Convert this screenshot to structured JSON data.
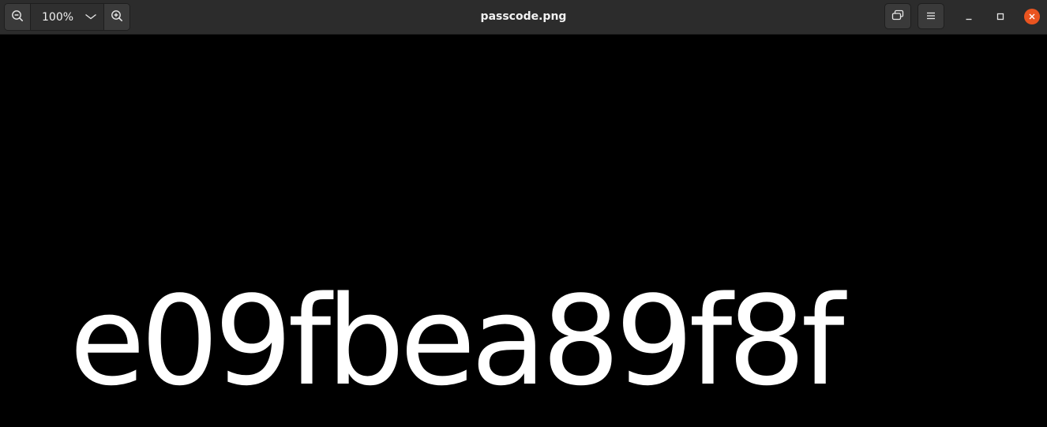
{
  "app": {
    "title": "passcode.png"
  },
  "toolbar": {
    "zoom_out_icon": "zoom-out-icon",
    "zoom_level": "100%",
    "zoom_dropdown_icon": "chevron-down-icon",
    "zoom_in_icon": "zoom-in-icon",
    "fit_window_icon": "restore-icon",
    "menu_icon": "hamburger-menu-icon"
  },
  "window_controls": {
    "minimize_icon": "minimize-icon",
    "maximize_icon": "maximize-icon",
    "close_icon": "close-icon",
    "close_color": "#e95420"
  },
  "image": {
    "text": "e09fbea89f8f",
    "background": "#000000",
    "foreground": "#ffffff"
  }
}
